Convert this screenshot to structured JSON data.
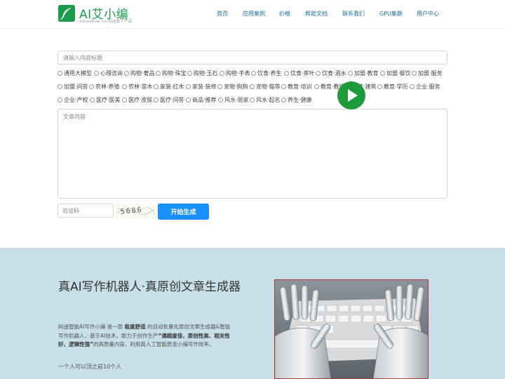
{
  "header": {
    "logo_title": "AI艾小编",
    "logo_sub": "aixiaobian.cn 码迷旗下产品",
    "nav": [
      "首页",
      "应用案例",
      "价格",
      "帮助文档",
      "联系我们",
      "GPU集群",
      "用户中心"
    ]
  },
  "form": {
    "title_placeholder": "请输入内容标题",
    "categories": [
      [
        "通用大模型",
        "心理咨询",
        "购物·奢品",
        "购物·珠宝",
        "购物·玉石",
        "购物·手表",
        "饮食·养生",
        "饮食·茶叶",
        "饮食·酒水",
        "加盟·教育",
        "加盟·餐饮",
        "加盟·服务"
      ],
      [
        "加盟·问答",
        "农林·养殖",
        "农林·苗木",
        "家装·红木",
        "家装·装修",
        "宠物·狗狗",
        "宠物·猫等",
        "教育·培训",
        "教育·教师",
        "教育·建筑",
        "教育·学历",
        "企业·服务"
      ],
      [
        "企业·产权",
        "医疗·医美",
        "医疗·皮肤",
        "医疗·问答",
        "商品·推荐",
        "风水·居家",
        "风水·起名",
        "养生·健康"
      ]
    ],
    "content_placeholder": "文章内容",
    "captcha_placeholder": "验证码",
    "captcha_text": "5686",
    "submit_label": "开始生成"
  },
  "hero": {
    "title": "真AI写作机器人·真原创文章生成器",
    "desc_1": "码迷智能AI写作小编 是一款 ",
    "desc_b1": "极度舒适",
    "desc_2": " 的自动批量化原创文章生成器&智能写作机器人，基于AI技术，致力于创作生产",
    "desc_b2": "“通顺度佳、原创性高、相关性好、逻辑性强”",
    "desc_3": "的高质量内容，利用真人工智能质变小编写作效率。",
    "tagline": "一个人可以顶之前10个人"
  },
  "colors": {
    "brand_green": "#1d9a4a",
    "nav_blue": "#1d6fa5",
    "button_blue": "#1890ff",
    "hero_bg": "#c7dfe8",
    "play_green": "#1d9a3a"
  }
}
